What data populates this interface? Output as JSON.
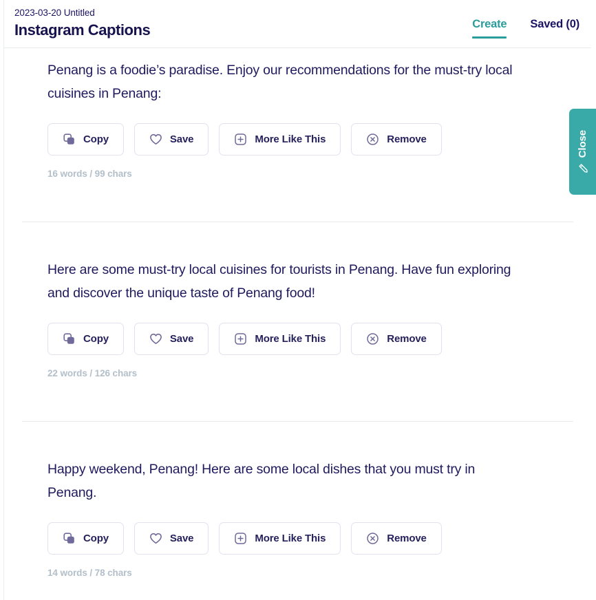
{
  "header": {
    "doc_date_title": "2023-03-20 Untitled",
    "page_title": "Instagram Captions",
    "tabs": [
      {
        "label": "Create",
        "active": true
      },
      {
        "label": "Saved (0)",
        "active": false
      }
    ]
  },
  "side_panel": {
    "close_label": "Close",
    "pencil_icon": "pencil-icon"
  },
  "actions": {
    "copy": {
      "label": "Copy",
      "icon": "copy-icon"
    },
    "save": {
      "label": "Save",
      "icon": "heart-icon"
    },
    "more_like_this": {
      "label": "More Like This",
      "icon": "plus-square-icon"
    },
    "remove": {
      "label": "Remove",
      "icon": "close-circle-icon"
    }
  },
  "results": [
    {
      "text": "Penang is a foodie’s paradise. Enjoy our recommendations for the must-try local cuisines in Penang:",
      "meta": "16 words / 99 chars"
    },
    {
      "text": "Here are some must-try local cuisines for tourists in Penang. Have fun exploring and discover the unique taste of Penang food!",
      "meta": "22 words / 126 chars"
    },
    {
      "text": "Happy weekend, Penang! Here are some local dishes that you must try in Penang.",
      "meta": "14 words / 78 chars"
    }
  ],
  "colors": {
    "accent_teal": "#2a9d9a",
    "side_tab_teal": "#3aaaa8",
    "text_navy": "#1f1a5e",
    "meta_gray": "#b3bfc9",
    "border_lavender": "#e2e1ee"
  }
}
